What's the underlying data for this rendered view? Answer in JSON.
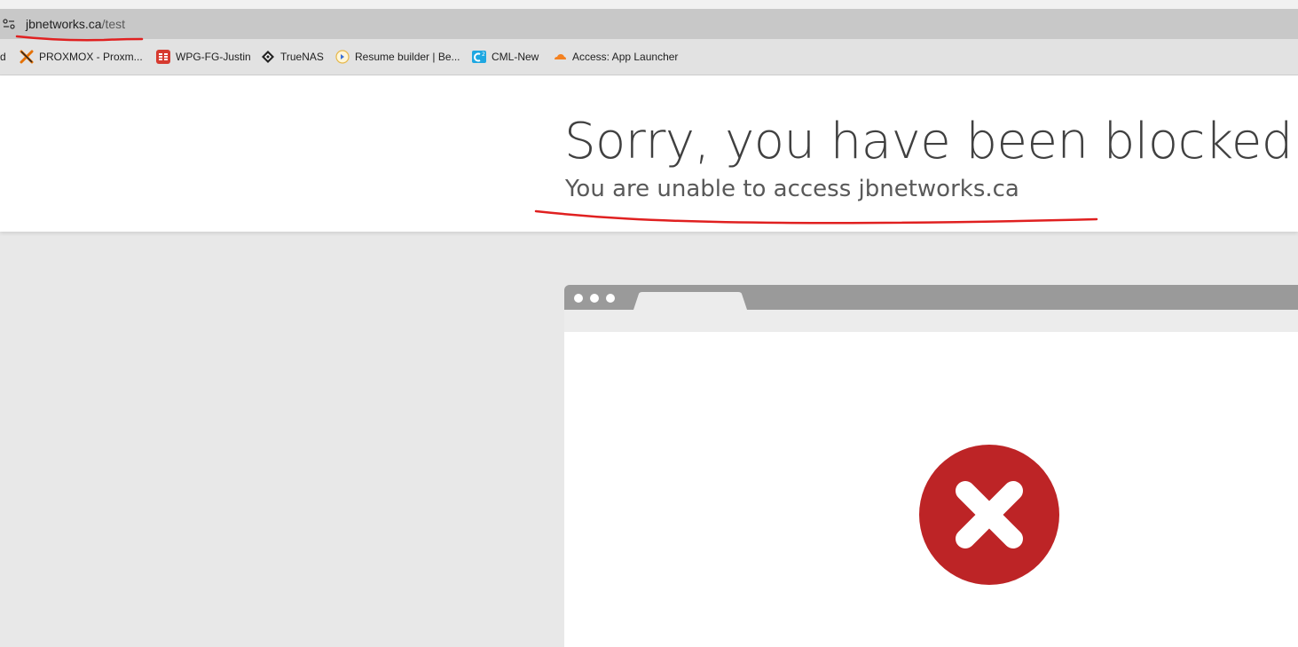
{
  "browser": {
    "url_host": "jbnetworks.ca",
    "url_path": "/test",
    "bookmarks": [
      {
        "label": "d",
        "icon": "folder-icon"
      },
      {
        "label": "PROXMOX - Proxm...",
        "icon": "proxmox-icon"
      },
      {
        "label": "WPG-FG-Justin",
        "icon": "fortigate-icon"
      },
      {
        "label": "TrueNAS",
        "icon": "truenas-icon"
      },
      {
        "label": "Resume builder | Be...",
        "icon": "resume-builder-icon"
      },
      {
        "label": "CML-New",
        "icon": "cml-icon"
      },
      {
        "label": "Access: App Launcher",
        "icon": "cloudflare-icon"
      }
    ]
  },
  "page": {
    "title": "Sorry, you have been blocked",
    "subtitle": "You are unable to access jbnetworks.ca"
  },
  "colors": {
    "annotation_red": "#e02020",
    "block_red": "#bd2426",
    "title_gray": "#404040",
    "illustration_gray": "#9a9a9a"
  }
}
